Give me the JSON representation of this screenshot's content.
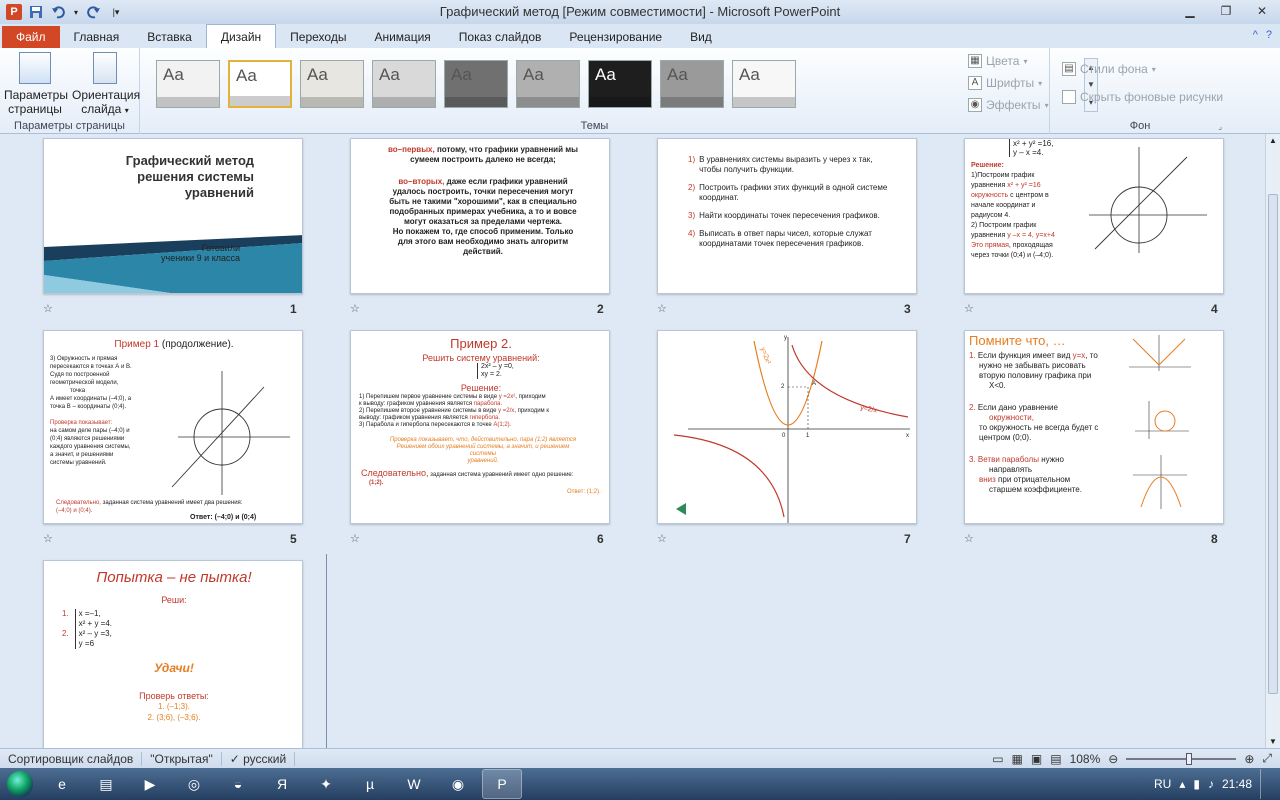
{
  "window": {
    "title": "Графический метод [Режим совместимости]  -  Microsoft PowerPoint",
    "app_icon_letter": "P"
  },
  "ribbon_tabs": [
    "Файл",
    "Главная",
    "Вставка",
    "Дизайн",
    "Переходы",
    "Анимация",
    "Показ слайдов",
    "Рецензирование",
    "Вид"
  ],
  "active_tab": "Дизайн",
  "ribbon": {
    "page_setup": {
      "btn_params_line1": "Параметры",
      "btn_params_line2": "страницы",
      "btn_orient_line1": "Ориентация",
      "btn_orient_line2": "слайда",
      "group_label": "Параметры страницы"
    },
    "themes": {
      "group_label": "Темы",
      "thumb_label": "Aa",
      "thumb_colors": [
        "#f2f2f2",
        "#ffffff",
        "#e8e6e0",
        "#d9d9d9",
        "#707070",
        "#b0b0b0",
        "#1e1e1e",
        "#9a9a9a",
        "#f7f7f7",
        "#ececec",
        "#f4f4f4"
      ],
      "colors_btn": "Цвета",
      "fonts_btn": "Шрифты",
      "effects_btn": "Эффекты"
    },
    "background": {
      "group_label": "Фон",
      "styles_btn": "Стили фона",
      "hide_bg_checkbox": "Скрыть фоновые рисунки"
    }
  },
  "slides": [
    {
      "num": "1",
      "title_l1": "Графический метод",
      "title_l2": "решения системы",
      "title_l3": "уравнений",
      "sub1": "Готовили",
      "sub2": "ученики 9 и класса"
    },
    {
      "num": "2",
      "l1a": "во–первых,",
      "l1b": " потому, что графики уравнений мы",
      "l2": "сумеем построить далеко не всегда;",
      "l3a": "во–вторых,",
      "l3b": " даже если графики уравнений",
      "l4": "удалось построить, точки пересечения могут",
      "l5": "быть не такими \"хорошими\", как в специально",
      "l6": "подобранных примерах учебника, а то и вовсе",
      "l7": "могут оказаться за пределами чертежа.",
      "l8": "Но покажем то, где способ применим. Только",
      "l9": "для этого вам необходимо знать алгоритм",
      "l10": "действий."
    },
    {
      "num": "3",
      "s1": "1)",
      "t1": "В уравнениях системы выразить y через x так, чтобы получить функции.",
      "s2": "2)",
      "t2": "Построить графики этих функций в одной системе координат.",
      "s3": "3)",
      "t3": "Найти координаты точек пересечения графиков.",
      "s4": "4)",
      "t4": "Выписать в ответ пары чисел, которые служат координатами точек пересечения графиков."
    },
    {
      "num": "4",
      "eq1": "x² + y² =16,",
      "eq2": "y – x =4.",
      "sol": "Решение:",
      "p1": "1)Построим график",
      "p2": "уравнения ",
      "p2r": "x² + y² =16",
      "p3r": "окружность",
      "p3": " с центром в",
      "p4": "начале координат и",
      "p5": "радиусом 4.",
      "p6": "2) Построим график",
      "p7": "уравнения ",
      "p7r": "y –x = 4, y=x+4",
      "p8r": "Это прямая",
      "p8": ", проходящая",
      "p9": "через точки (0;4) и (–4;0)."
    },
    {
      "num": "5",
      "title": "Пример 1",
      "title2": " (продолжение).",
      "a1": "3) Окружность и прямая",
      "a2": "пересекаются в точках А и В.",
      "a3": "Судя по построенной",
      "a4": "геометрической модели,",
      "a5": "точка",
      "a6": "А имеет координаты (–4;0), а",
      "a7": "точка В – координаты (0;4).",
      "b1": "Проверка показывает:",
      "b2": "на самом деле пары (–4;0) и",
      "b3": "(0;4) являются решениями",
      "b4": "каждого уравнения системы,",
      "b5": "а значит, и решениями",
      "b6": "системы уравнений.",
      "c1": "Следовательно,",
      "c2": " заданная система уравнений имеет два решения:",
      "c3": "(–4;0) и (0;4).",
      "ans": "Ответ: (–4;0) и (0;4)"
    },
    {
      "num": "6",
      "title": "Пример 2.",
      "sub": "Решить систему уравнений:",
      "e1": "2x² – y =0,",
      "e2": "xy = 2.",
      "sol": "Решение:",
      "r1a": "1) Перепишем первое уравнение системы в виде ",
      "r1b": "y =2x²",
      "r1c": ", приходим",
      "r1d": "к выводу: графиком уравнения является ",
      "r1e": "парабола.",
      "r2a": "2) Перепишем второе уравнение системы в виде ",
      "r2b": "y =2/x",
      "r2c": ", приходим к",
      "r2d": "выводу: графиком уравнения является ",
      "r2e": "гипербола.",
      "r3a": "3) Парабола и гипербола пересекаются в точке ",
      "r3b": "А(1;2).",
      "ch1": "Проверка показывает, что, действительно, пара (1;2) является",
      "ch2": "Решением обоих уравнений системы, а значит, и решением",
      "ch3": "системы",
      "ch4": "уравнений.",
      "f1": "Следовательно,",
      "f2": " заданная система уравнений имеет одно решение:",
      "f3": "(1;2).",
      "ans": "Ответ: (1;2)."
    },
    {
      "num": "7",
      "lbl_parab": "y=2x²",
      "lbl_hyp": "y=2/x",
      "lbl_y": "y",
      "lbl_x": "x",
      "lbl_a": "A",
      "lbl_2": "2",
      "lbl_1": "1",
      "lbl_0": "0"
    },
    {
      "num": "8",
      "title": "Помните что, …",
      "i1a": "1.",
      "i1b": " Если функция имеет вид ",
      "i1c": "y=x",
      "i1d": ", то",
      "i1e": "нужно не забывать рисовать",
      "i1f": "вторую половину графика при",
      "i1g": "X<0.",
      "i2a": "2.",
      "i2b": " Если дано уравнение",
      "i2c": "окружности,",
      "i2d": "то окружность не всегда будет с",
      "i2e": "центром (0;0).",
      "i3a": "3.",
      "i3b": " Ветви параболы",
      "i3c": " нужно",
      "i3d": "направлять",
      "i3e": "вниз",
      "i3f": " при отрицательном",
      "i3g": "старшем коэффициенте."
    },
    {
      "num": "9",
      "title": "Попытка – не пытка!",
      "solve": "Реши:",
      "n1": "1.",
      "q1a": "x =–1,",
      "q1b": "x² + y =4.",
      "n2": "2.",
      "q2a": "x² – y =3,",
      "q2b": "y =6",
      "luck": "Удачи!",
      "check": "Проверь ответы:",
      "ans1": "1. (–1;3).",
      "ans2": "2. (3;6), (–3;6)."
    }
  ],
  "status": {
    "view": "Сортировщик слайдов",
    "theme": "\"Открытая\"",
    "lang": "русский",
    "zoom": "108%"
  },
  "taskbar": {
    "lang": "RU",
    "time": "21:48"
  }
}
